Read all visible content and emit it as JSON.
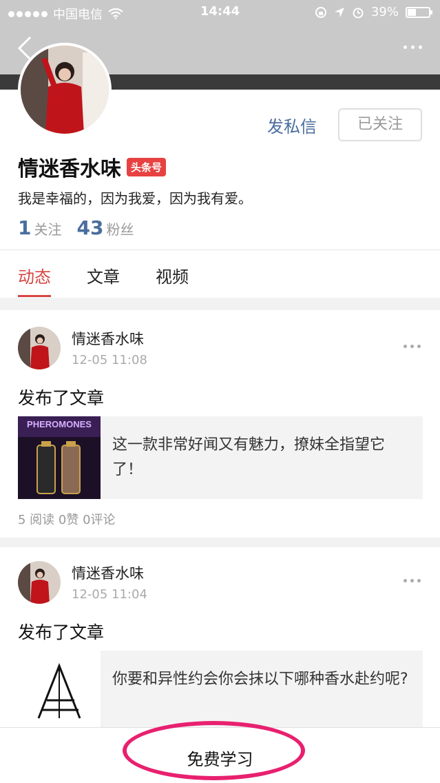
{
  "status_bar": {
    "carrier": "中国电信",
    "time": "14:44",
    "battery": "39%",
    "battery_level": 0.39
  },
  "profile": {
    "name": "情迷香水味",
    "badge": "头条号",
    "bio": "我是幸福的，因为我爱，因为我有爱。",
    "following_count": "1",
    "following_label": "关注",
    "followers_count": "43",
    "followers_label": "粉丝",
    "message_label": "发私信",
    "follow_label": "已关注"
  },
  "tabs": [
    {
      "label": "动态",
      "active": true
    },
    {
      "label": "文章",
      "active": false
    },
    {
      "label": "视频",
      "active": false
    }
  ],
  "posts": [
    {
      "author": "情迷香水味",
      "time": "12-05 11:08",
      "action": "发布了文章",
      "card_title": "这一款非常好闻又有魅力，撩妹全指望它了！",
      "thumb_text": "PHEROMONES",
      "metrics": "5 阅读  0赞  0评论"
    },
    {
      "author": "情迷香水味",
      "time": "12-05 11:04",
      "action": "发布了文章",
      "card_title": "你要和异性约会你会抹以下哪种香水赴约呢?"
    }
  ],
  "bottom": {
    "learn_label": "免费学习"
  },
  "colors": {
    "accent_blue": "#4a6d9e",
    "tab_red": "#d64541",
    "badge_red": "#e84141",
    "highlight_pink": "#e8206f"
  }
}
